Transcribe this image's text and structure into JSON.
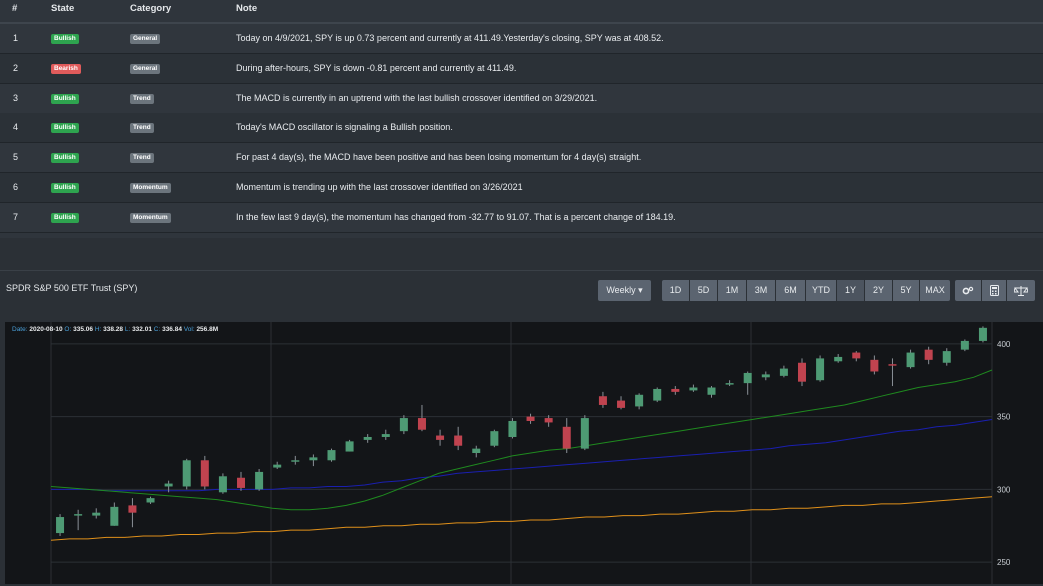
{
  "table": {
    "headers": {
      "num": "#",
      "state": "State",
      "category": "Category",
      "note": "Note"
    },
    "rows": [
      {
        "num": "1",
        "state": "Bullish",
        "category": "General",
        "note": "Today on 4/9/2021, SPY is up 0.73 percent and currently at 411.49.Yesterday's closing, SPY was at 408.52."
      },
      {
        "num": "2",
        "state": "Bearish",
        "category": "General",
        "note": "During after-hours, SPY is down -0.81 percent and currently at 411.49."
      },
      {
        "num": "3",
        "state": "Bullish",
        "category": "Trend",
        "note": "The MACD is currently in an uptrend with the last bullish crossover identified on 3/29/2021."
      },
      {
        "num": "4",
        "state": "Bullish",
        "category": "Trend",
        "note": "Today's MACD oscillator is signaling a Bullish position."
      },
      {
        "num": "5",
        "state": "Bullish",
        "category": "Trend",
        "note": "For past 4 day(s), the MACD have been positive and has been losing momentum for 4 day(s) straight."
      },
      {
        "num": "6",
        "state": "Bullish",
        "category": "Momentum",
        "note": "Momentum is trending up with the last crossover identified on 3/26/2021"
      },
      {
        "num": "7",
        "state": "Bullish",
        "category": "Momentum",
        "note": "In the few last 9 day(s), the momentum has changed from -32.77 to 91.07. That is a percent change of 184.19."
      }
    ]
  },
  "chart_header": {
    "title": "SPDR S&P 500 ETF Trust (SPY)",
    "interval_label": "Weekly ▾",
    "ranges": [
      "1D",
      "5D",
      "1M",
      "3M",
      "6M",
      "YTD",
      "1Y",
      "2Y",
      "5Y",
      "MAX"
    ],
    "active_range": "1Y",
    "tools": [
      "settings-icon",
      "calculator-icon",
      "scale-icon"
    ]
  },
  "ohlc": {
    "date_key": "Date:",
    "date": "2020-08-10",
    "open_key": "O:",
    "open": "335.06",
    "high_key": "H:",
    "high": "338.28",
    "low_key": "L:",
    "low": "332.01",
    "close_key": "C:",
    "close": "336.84",
    "vol_key": "Vol:",
    "vol": "256.8M"
  },
  "colors": {
    "up": "#4e9a74",
    "down": "#c0434f",
    "ma_green": "#1f8a1f",
    "ma_blue": "#1a1fb0",
    "ma_orange": "#e0901a"
  },
  "chart_data": {
    "type": "candlestick",
    "y_ticks": [
      400,
      350,
      300,
      250
    ],
    "ylim": [
      235,
      415
    ],
    "candles": [
      {
        "o": 270,
        "h": 283,
        "l": 268,
        "c": 281
      },
      {
        "o": 282,
        "h": 286,
        "l": 272,
        "c": 283
      },
      {
        "o": 282,
        "h": 287,
        "l": 280,
        "c": 284
      },
      {
        "o": 275,
        "h": 291,
        "l": 275,
        "c": 288
      },
      {
        "o": 289,
        "h": 294,
        "l": 274,
        "c": 284
      },
      {
        "o": 291,
        "h": 295,
        "l": 290,
        "c": 294
      },
      {
        "o": 302,
        "h": 306,
        "l": 298,
        "c": 304
      },
      {
        "o": 302,
        "h": 321,
        "l": 300,
        "c": 320
      },
      {
        "o": 320,
        "h": 323,
        "l": 300,
        "c": 302
      },
      {
        "o": 298,
        "h": 311,
        "l": 297,
        "c": 309
      },
      {
        "o": 308,
        "h": 312,
        "l": 299,
        "c": 301
      },
      {
        "o": 300,
        "h": 314,
        "l": 299,
        "c": 312
      },
      {
        "o": 315,
        "h": 319,
        "l": 314,
        "c": 317
      },
      {
        "o": 319,
        "h": 323,
        "l": 317,
        "c": 320
      },
      {
        "o": 320,
        "h": 324,
        "l": 316,
        "c": 322
      },
      {
        "o": 320,
        "h": 328,
        "l": 319,
        "c": 327
      },
      {
        "o": 326,
        "h": 334,
        "l": 326,
        "c": 333
      },
      {
        "o": 334,
        "h": 338,
        "l": 332,
        "c": 336
      },
      {
        "o": 336,
        "h": 341,
        "l": 334,
        "c": 338
      },
      {
        "o": 340,
        "h": 351,
        "l": 338,
        "c": 349
      },
      {
        "o": 349,
        "h": 358,
        "l": 340,
        "c": 341
      },
      {
        "o": 337,
        "h": 341,
        "l": 330,
        "c": 334
      },
      {
        "o": 337,
        "h": 343,
        "l": 327,
        "c": 330
      },
      {
        "o": 325,
        "h": 330,
        "l": 322,
        "c": 328
      },
      {
        "o": 330,
        "h": 341,
        "l": 329,
        "c": 340
      },
      {
        "o": 336,
        "h": 349,
        "l": 335,
        "c": 347
      },
      {
        "o": 350,
        "h": 352,
        "l": 345,
        "c": 347
      },
      {
        "o": 349,
        "h": 351,
        "l": 343,
        "c": 346
      },
      {
        "o": 343,
        "h": 349,
        "l": 325,
        "c": 328
      },
      {
        "o": 328,
        "h": 351,
        "l": 327,
        "c": 349
      },
      {
        "o": 364,
        "h": 367,
        "l": 356,
        "c": 358
      },
      {
        "o": 361,
        "h": 364,
        "l": 355,
        "c": 356
      },
      {
        "o": 357,
        "h": 366,
        "l": 355,
        "c": 365
      },
      {
        "o": 361,
        "h": 370,
        "l": 360,
        "c": 369
      },
      {
        "o": 369,
        "h": 371,
        "l": 365,
        "c": 367
      },
      {
        "o": 368,
        "h": 372,
        "l": 367,
        "c": 370
      },
      {
        "o": 365,
        "h": 371,
        "l": 363,
        "c": 370
      },
      {
        "o": 372,
        "h": 375,
        "l": 371,
        "c": 373
      },
      {
        "o": 373,
        "h": 381,
        "l": 365,
        "c": 380
      },
      {
        "o": 377,
        "h": 381,
        "l": 375,
        "c": 379
      },
      {
        "o": 378,
        "h": 385,
        "l": 377,
        "c": 383
      },
      {
        "o": 387,
        "h": 390,
        "l": 371,
        "c": 374
      },
      {
        "o": 375,
        "h": 392,
        "l": 374,
        "c": 390
      },
      {
        "o": 388,
        "h": 393,
        "l": 387,
        "c": 391
      },
      {
        "o": 394,
        "h": 395,
        "l": 388,
        "c": 390
      },
      {
        "o": 389,
        "h": 392,
        "l": 379,
        "c": 381
      },
      {
        "o": 386,
        "h": 390,
        "l": 371,
        "c": 385
      },
      {
        "o": 384,
        "h": 396,
        "l": 383,
        "c": 394
      },
      {
        "o": 396,
        "h": 398,
        "l": 386,
        "c": 389
      },
      {
        "o": 387,
        "h": 397,
        "l": 385,
        "c": 395
      },
      {
        "o": 396,
        "h": 403,
        "l": 395,
        "c": 402
      },
      {
        "o": 402,
        "h": 412,
        "l": 401,
        "c": 411
      }
    ],
    "ma_green": [
      302,
      301,
      300,
      299,
      298,
      297,
      296,
      295,
      294,
      293,
      291,
      289,
      287,
      286,
      286,
      287,
      289,
      292,
      296,
      301,
      306,
      311,
      314,
      317,
      320,
      323,
      325,
      327,
      328,
      330,
      332,
      334,
      336,
      338,
      340,
      342,
      344,
      346,
      348,
      350,
      352,
      354,
      356,
      358,
      361,
      364,
      367,
      370,
      372,
      374,
      377,
      382
    ],
    "ma_blue": [
      300,
      300,
      300,
      299,
      299,
      299,
      299,
      299,
      299,
      300,
      300,
      300,
      300,
      301,
      301,
      302,
      302,
      303,
      305,
      306,
      308,
      309,
      311,
      312,
      313,
      314,
      315,
      316,
      317,
      318,
      319,
      320,
      321,
      322,
      323,
      324,
      325,
      326,
      327,
      328,
      330,
      331,
      332,
      334,
      336,
      338,
      340,
      341,
      343,
      344,
      346,
      348
    ],
    "ma_orange": [
      265,
      266,
      266,
      267,
      267,
      268,
      268,
      269,
      269,
      270,
      270,
      271,
      271,
      272,
      272,
      273,
      274,
      274,
      275,
      275,
      276,
      276,
      277,
      277,
      278,
      278,
      279,
      279,
      280,
      281,
      281,
      282,
      282,
      283,
      283,
      284,
      285,
      285,
      286,
      286,
      287,
      287,
      288,
      289,
      289,
      290,
      290,
      291,
      292,
      293,
      294,
      295
    ]
  }
}
